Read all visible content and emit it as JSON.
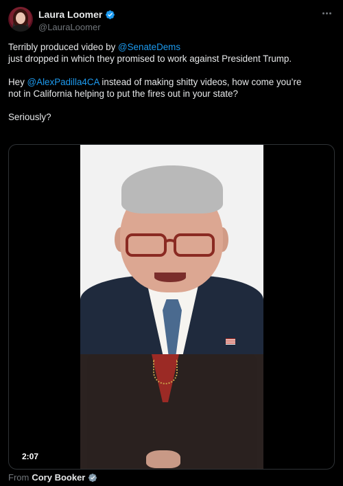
{
  "author": {
    "display_name": "Laura Loomer",
    "handle": "@LauraLoomer",
    "verified_color": "#1d9bf0"
  },
  "more_icon": "more-horizontal-icon",
  "tweet": {
    "line1_prefix": "Terribly produced video by ",
    "line1_mention": "@SenateDems",
    "line2": "just dropped in which they promised to work against President Trump.",
    "line3_prefix": "Hey ",
    "line3_mention": "@AlexPadilla4CA",
    "line3_suffix": " instead of making shitty videos, how come you’re",
    "line4": "not in California helping to put the fires out in your state?",
    "line5": "Seriously?"
  },
  "media": {
    "duration": "2:07"
  },
  "attribution": {
    "prefix": "From",
    "author": "Cory Booker"
  },
  "colors": {
    "background": "#000000",
    "text": "#e7e9ea",
    "secondary": "#71767b",
    "link": "#1d9bf0"
  }
}
